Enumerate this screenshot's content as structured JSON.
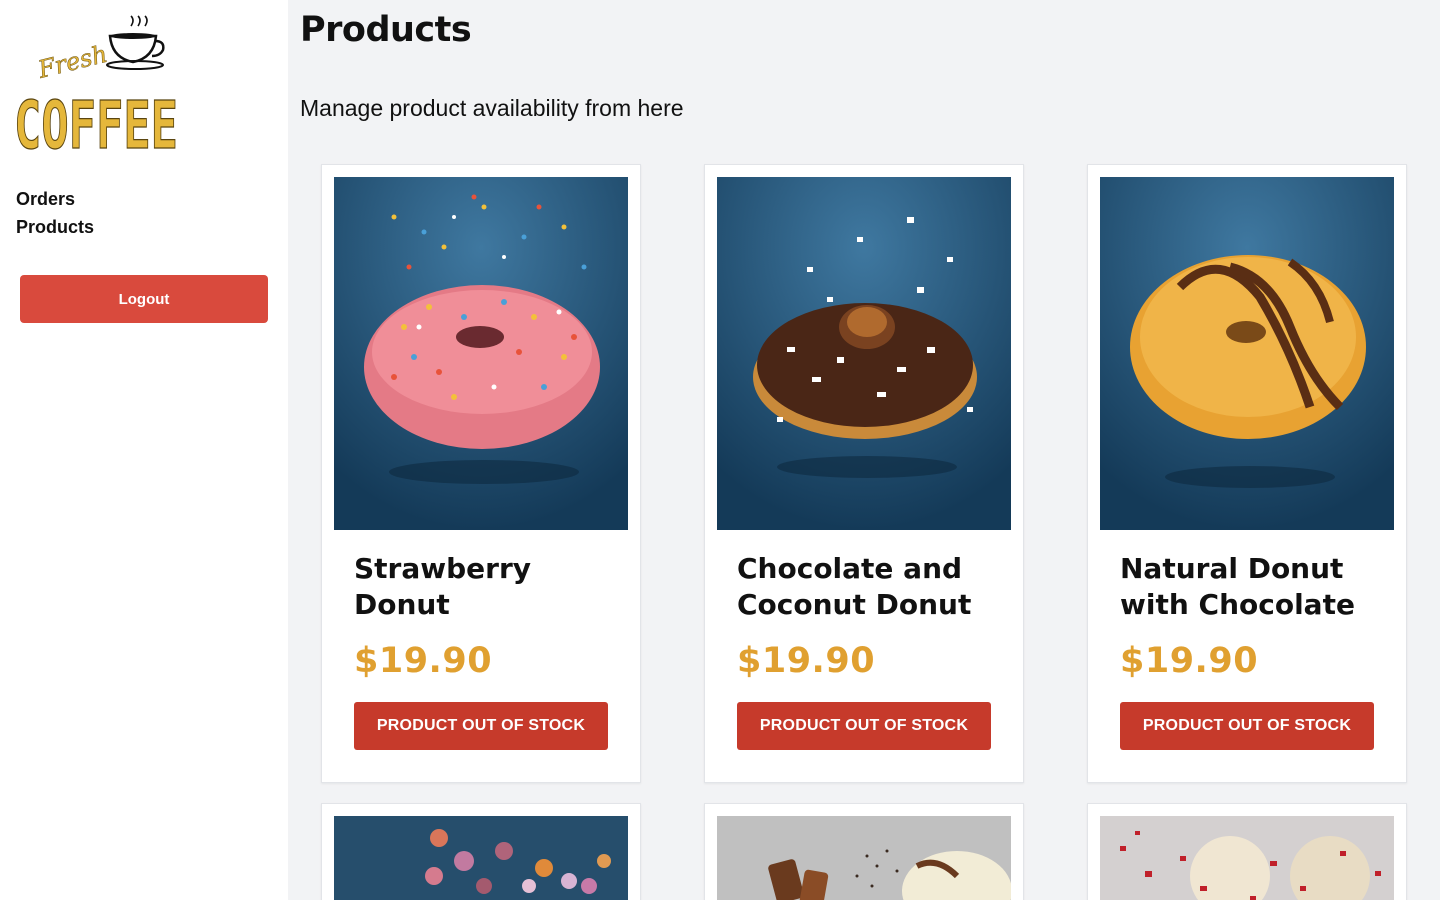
{
  "sidebar": {
    "logo": {
      "script_text": "Fresh",
      "main_text": "COFFEE"
    },
    "nav": [
      {
        "label": "Orders"
      },
      {
        "label": "Products"
      }
    ],
    "logout_label": "Logout"
  },
  "main": {
    "title": "Products",
    "subtitle": "Manage product availability from here",
    "products": [
      {
        "name": "Strawberry Donut",
        "price": "$19.90",
        "button_label": "PRODUCT OUT OF STOCK",
        "image": "strawberry-sprinkle-donut"
      },
      {
        "name": "Chocolate and Coconut Donut",
        "price": "$19.90",
        "button_label": "PRODUCT OUT OF STOCK",
        "image": "chocolate-coconut-donut"
      },
      {
        "name": "Natural Donut with Chocolate",
        "price": "$19.90",
        "button_label": "PRODUCT OUT OF STOCK",
        "image": "natural-chocolate-drizzle-donut"
      },
      {
        "image": "colored-candy-balls-donut"
      },
      {
        "image": "chocolate-pieces-donut"
      },
      {
        "image": "raspberry-crumble-donut"
      }
    ]
  },
  "colors": {
    "accent": "#d94a3d",
    "button": "#c63a2b",
    "price": "#e0a030",
    "background": "#f2f3f5",
    "logo": "#e5b73b"
  }
}
